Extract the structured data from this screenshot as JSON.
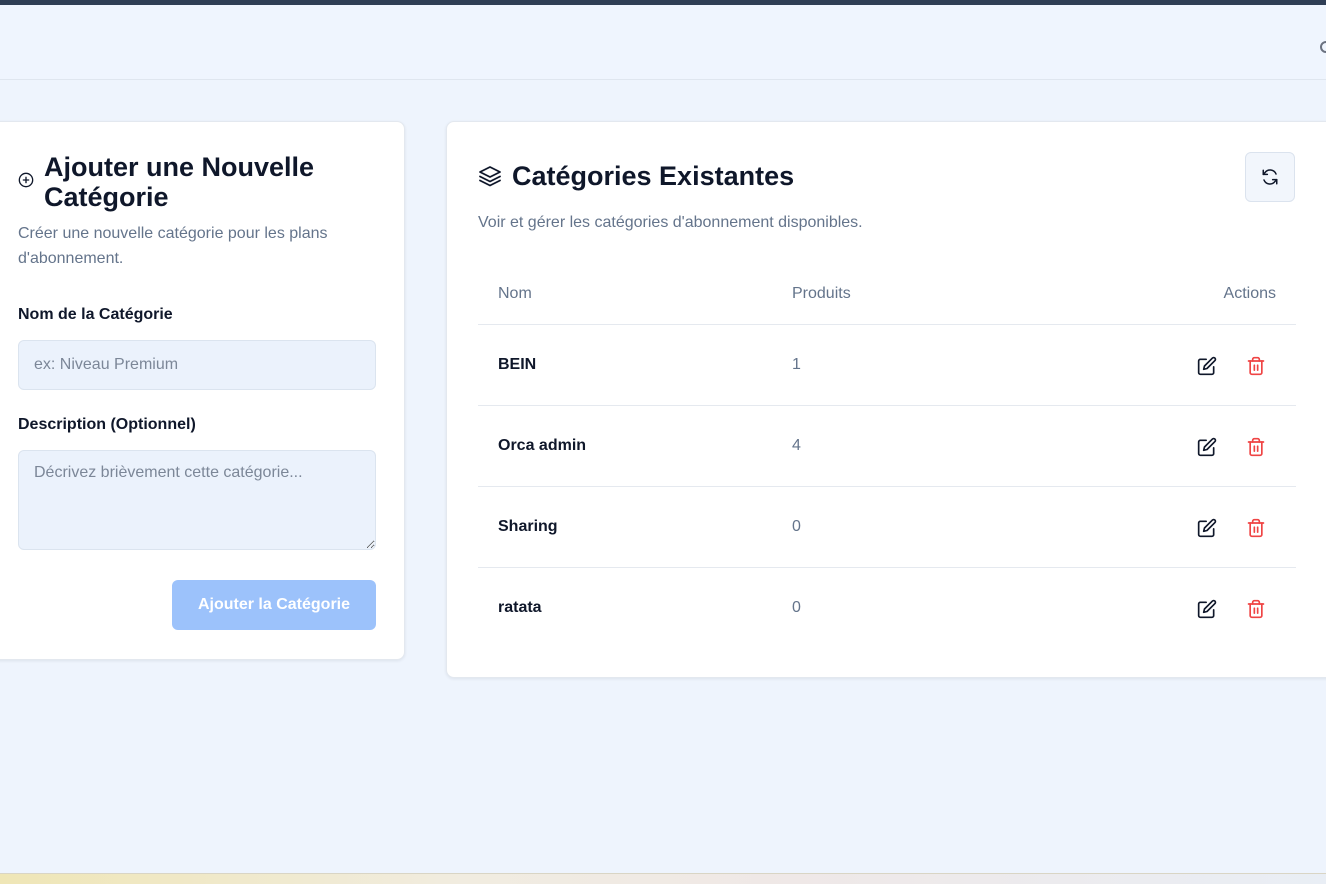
{
  "left_panel": {
    "title": "Ajouter une Nouvelle Catégorie",
    "description": "Créer une nouvelle catégorie pour les plans d'abonnement.",
    "name_label": "Nom de la Catégorie",
    "name_placeholder": "ex: Niveau Premium",
    "name_value": "",
    "description_label": "Description (Optionnel)",
    "description_placeholder": "Décrivez brièvement cette catégorie...",
    "description_value": "",
    "submit_label": "Ajouter la Catégorie",
    "icon": "plus-circle-icon"
  },
  "right_panel": {
    "title": "Catégories Existantes",
    "description": "Voir et gérer les catégories d'abonnement disponibles.",
    "icon": "layers-icon",
    "refresh_icon": "refresh-icon",
    "columns": {
      "name": "Nom",
      "products": "Produits",
      "actions": "Actions"
    },
    "rows": [
      {
        "name": "BEIN",
        "products": "1"
      },
      {
        "name": "Orca admin",
        "products": "4"
      },
      {
        "name": "Sharing",
        "products": "0"
      },
      {
        "name": "ratata",
        "products": "0"
      }
    ]
  },
  "colors": {
    "page_background": "#eef4fd",
    "card_background": "#ffffff",
    "submit_disabled": "#9cc2fb",
    "delete": "#ef4444",
    "muted_text": "#64748b"
  }
}
